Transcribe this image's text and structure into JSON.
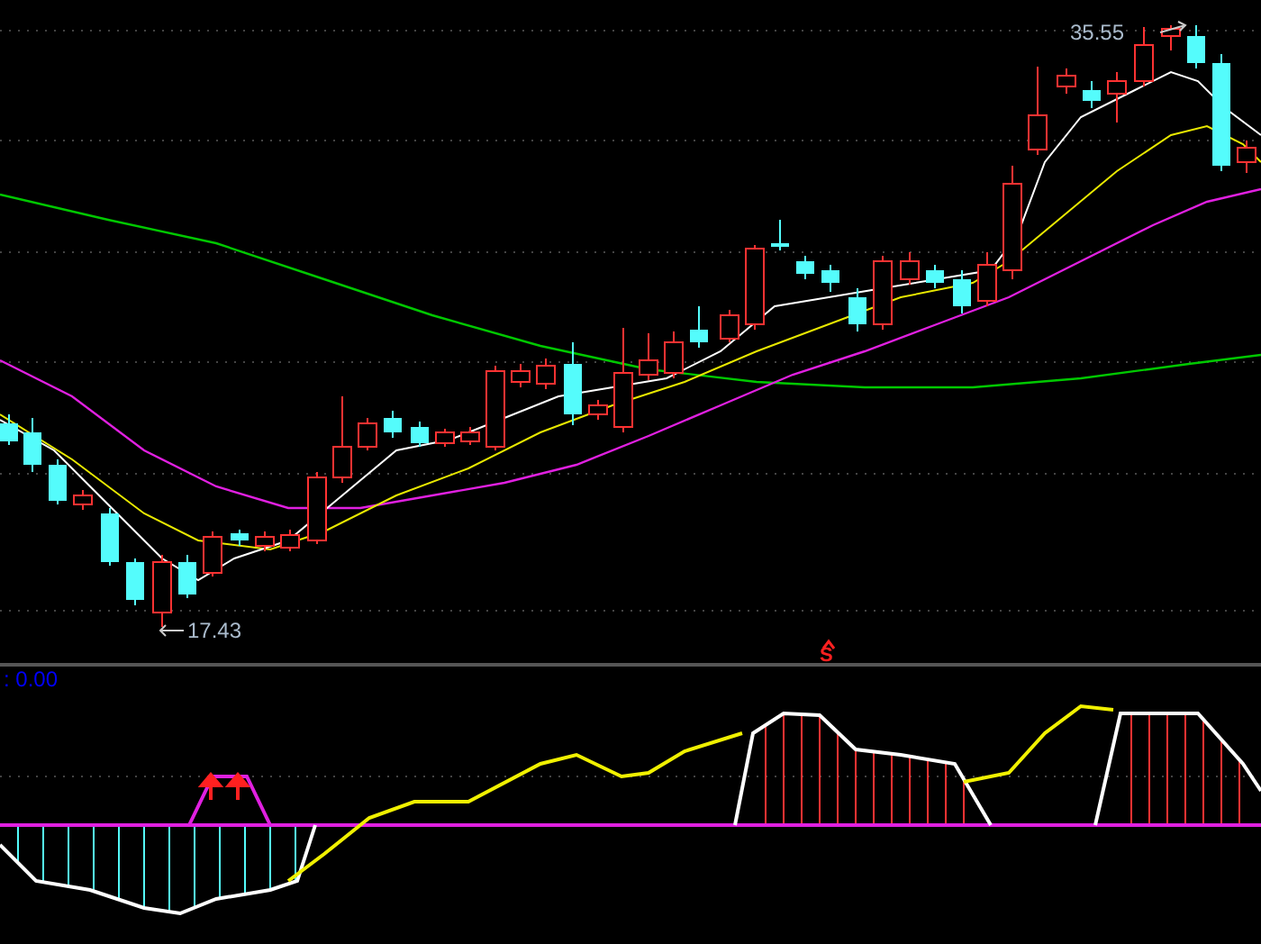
{
  "price_chart": {
    "high_label": "35.55",
    "low_label": "17.43",
    "signal_marker": "S"
  },
  "indicator_panel": {
    "value_label": ": 0.00"
  }
}
